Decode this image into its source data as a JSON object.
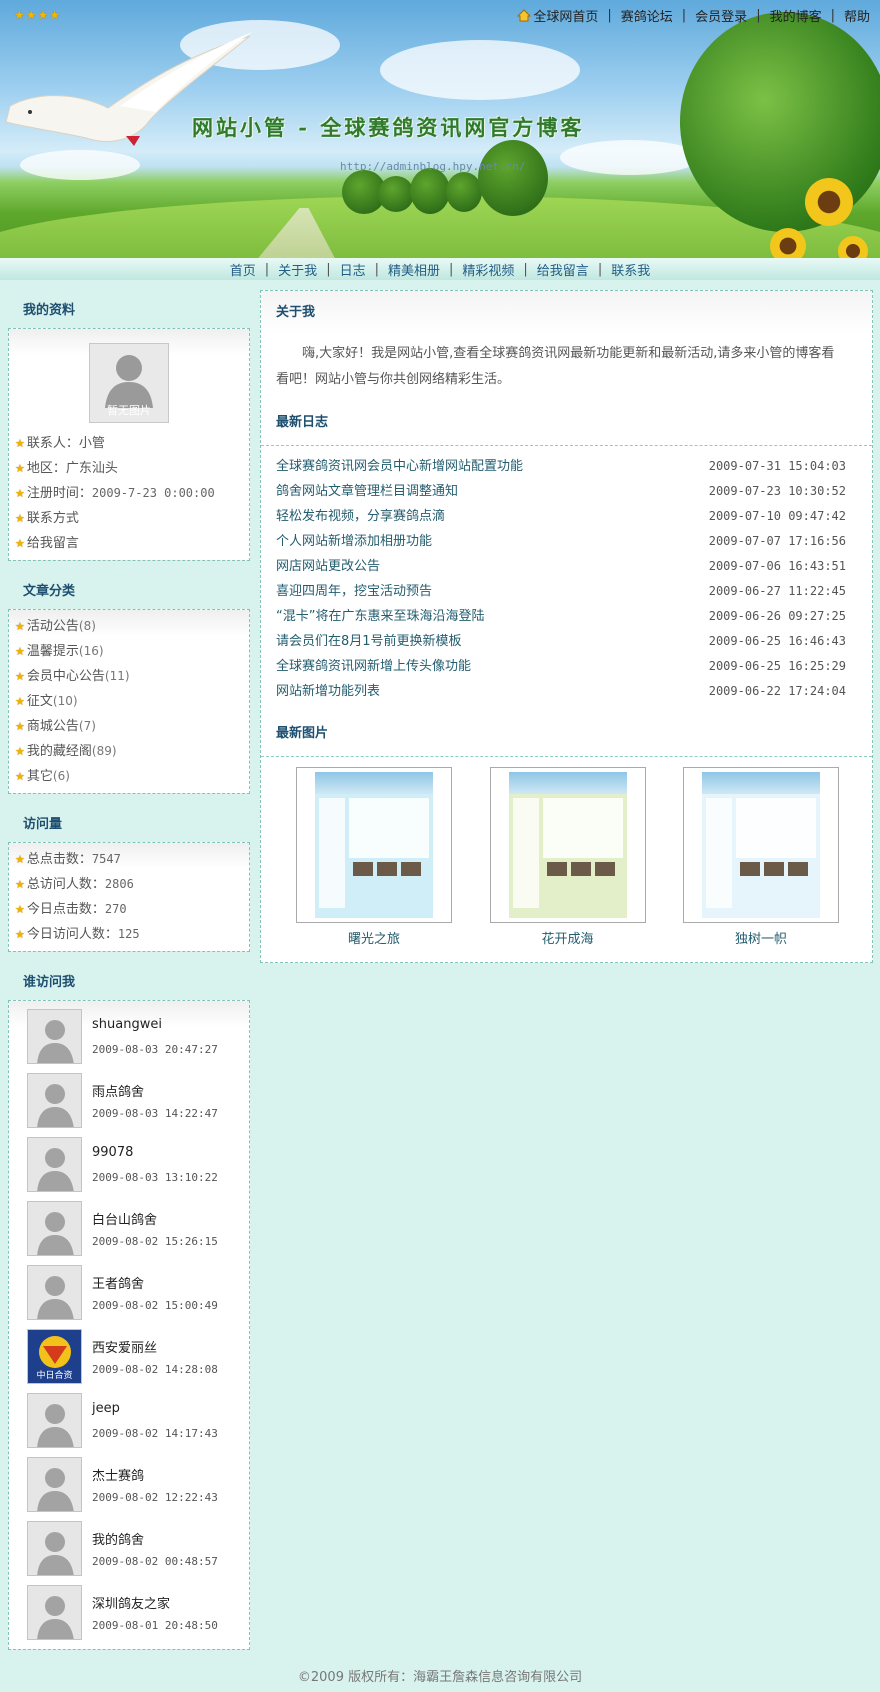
{
  "header": {
    "stars": "★★★★",
    "title": "网站小管 - 全球赛鸽资讯网官方博客",
    "url": "http://adminblog.hpy.net.cn/",
    "top_links": [
      "全球网首页",
      "赛鸽论坛",
      "会员登录",
      "我的博客",
      "帮助"
    ]
  },
  "nav": [
    "首页",
    "关于我",
    "日志",
    "精美相册",
    "精彩视频",
    "给我留言",
    "联系我"
  ],
  "profile": {
    "title": "我的资料",
    "no_pic": "暂无图片",
    "contact_label": "联系人：",
    "contact": "小管",
    "region_label": "地区：",
    "region": "广东汕头",
    "reg_label": "注册时间：",
    "reg_time": "2009-7-23 0:00:00",
    "contact_link": "联系方式",
    "message_link": "给我留言"
  },
  "categories": {
    "title": "文章分类",
    "items": [
      {
        "name": "活动公告",
        "count": "(8)"
      },
      {
        "name": "温馨提示",
        "count": "(16)"
      },
      {
        "name": "会员中心公告",
        "count": "(11)"
      },
      {
        "name": "征文",
        "count": "(10)"
      },
      {
        "name": "商城公告",
        "count": "(7)"
      },
      {
        "name": "我的藏经阁",
        "count": "(89)"
      },
      {
        "name": "其它",
        "count": "(6)"
      }
    ]
  },
  "stats": {
    "title": "访问量",
    "items": [
      {
        "label": "总点击数：",
        "value": "7547"
      },
      {
        "label": "总访问人数：",
        "value": "2806"
      },
      {
        "label": "今日点击数：",
        "value": "270"
      },
      {
        "label": "今日访问人数：",
        "value": "125"
      }
    ]
  },
  "visitors": {
    "title": "谁访问我",
    "logo_text": "中日合资",
    "items": [
      {
        "name": "shuangwei",
        "date": "2009-08-03 20:47:27"
      },
      {
        "name": "雨点鸽舍",
        "date": "2009-08-03 14:22:47"
      },
      {
        "name": "99078",
        "date": "2009-08-03 13:10:22"
      },
      {
        "name": "白台山鸽舍",
        "date": "2009-08-02 15:26:15"
      },
      {
        "name": "王者鸽舍",
        "date": "2009-08-02 15:00:49"
      },
      {
        "name": "西安爱丽丝",
        "date": "2009-08-02 14:28:08"
      },
      {
        "name": "jeep",
        "date": "2009-08-02 14:17:43"
      },
      {
        "name": "杰士赛鸽",
        "date": "2009-08-02 12:22:43"
      },
      {
        "name": "我的鸽舍",
        "date": "2009-08-02 00:48:57"
      },
      {
        "name": "深圳鸽友之家",
        "date": "2009-08-01 20:48:50"
      }
    ]
  },
  "about": {
    "title": "关于我",
    "text": "嗨,大家好！我是网站小管,查看全球赛鸽资讯网最新功能更新和最新活动,请多来小管的博客看看吧！网站小管与你共创网络精彩生活。"
  },
  "logs": {
    "title": "最新日志",
    "items": [
      {
        "title": "全球赛鸽资讯网会员中心新增网站配置功能",
        "date": "2009-07-31 15:04:03"
      },
      {
        "title": "鸽舍网站文章管理栏目调整通知",
        "date": "2009-07-23 10:30:52"
      },
      {
        "title": "轻松发布视频，分享赛鸽点滴",
        "date": "2009-07-10 09:47:42"
      },
      {
        "title": "个人网站新增添加相册功能",
        "date": "2009-07-07 17:16:56"
      },
      {
        "title": "网店网站更改公告",
        "date": "2009-07-06 16:43:51"
      },
      {
        "title": "喜迎四周年，挖宝活动预告",
        "date": "2009-06-27 11:22:45"
      },
      {
        "title": "“混卡”将在广东惠来至珠海沿海登陆",
        "date": "2009-06-26 09:27:25"
      },
      {
        "title": "请会员们在8月1号前更换新模板",
        "date": "2009-06-25 16:46:43"
      },
      {
        "title": "全球赛鸽资讯网新增上传头像功能",
        "date": "2009-06-25 16:25:29"
      },
      {
        "title": "网站新增功能列表",
        "date": "2009-06-22 17:24:04"
      }
    ]
  },
  "photos": {
    "title": "最新图片",
    "items": [
      {
        "caption": "曙光之旅",
        "theme": "#cfeef7"
      },
      {
        "caption": "花开成海",
        "theme": "#e3efc9"
      },
      {
        "caption": "独树一帜",
        "theme": "#e6f4fb"
      }
    ]
  },
  "footer": "©2009 版权所有：海霸王詹森信息咨询有限公司",
  "colors": {
    "accent": "#1e4f70",
    "link": "#245d6e",
    "border": "#7fc4b8",
    "page_bg": "#d8f3ee"
  }
}
